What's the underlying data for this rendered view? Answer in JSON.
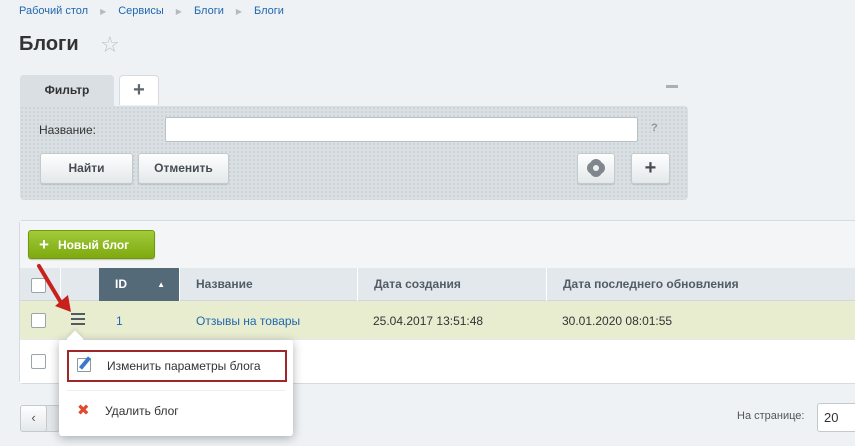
{
  "breadcrumb": [
    "Рабочий стол",
    "Сервисы",
    "Блоги",
    "Блоги"
  ],
  "page": {
    "title": "Блоги"
  },
  "filter": {
    "tab_label": "Фильтр",
    "add_tab": "+",
    "name_label": "Название:",
    "name_value": "",
    "help": "?",
    "find_button": "Найти",
    "cancel_button": "Отменить",
    "add_button": "+"
  },
  "toolbar": {
    "new_blog": "Новый блог",
    "plus": "+"
  },
  "table": {
    "columns": {
      "id": "ID",
      "name": "Название",
      "created": "Дата создания",
      "updated": "Дата последнего обновления"
    },
    "sort_indicator": "▲",
    "rows": [
      {
        "id": "1",
        "name": "Отзывы на товары",
        "created": "25.04.2017 13:51:48",
        "updated": "30.01.2020 08:01:55"
      }
    ]
  },
  "context_menu": {
    "edit": "Изменить параметры блога",
    "delete": "Удалить блог"
  },
  "pager": {
    "prev": "‹",
    "per_page_label": "На странице:",
    "per_page_value": "20"
  },
  "icons": {
    "star": "star-icon",
    "gear": "gear-icon",
    "menu": "hamburger-menu-icon",
    "edit": "edit-icon",
    "delete": "delete-icon"
  },
  "colors": {
    "accent_green": "#8cb820",
    "link_blue": "#2067b0",
    "id_header": "#546a79",
    "annotation_red": "#c8201d",
    "selected_row": "#e8edd0"
  }
}
